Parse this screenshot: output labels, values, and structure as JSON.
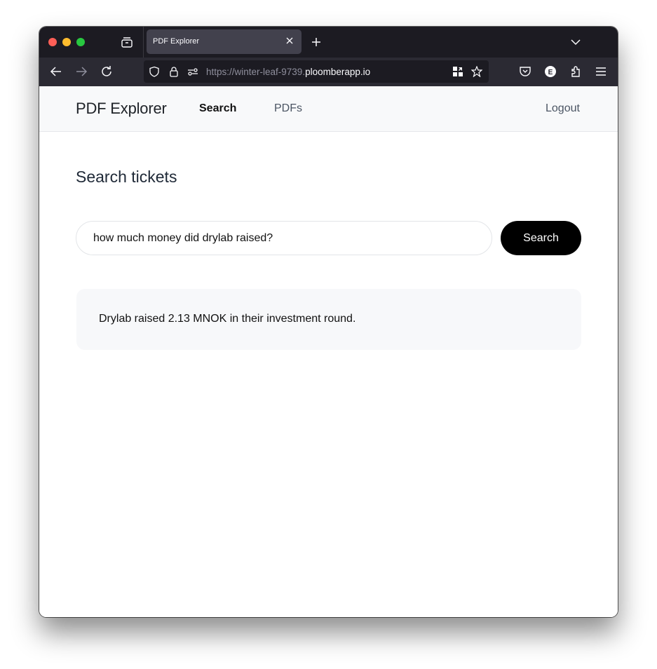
{
  "browser": {
    "tab": {
      "title": "PDF Explorer"
    },
    "url": {
      "scheme_and_subdomain": "https://winter-leaf-9739.",
      "host": "ploomberapp.io"
    },
    "icons": {
      "close_window": "close-window-icon",
      "minimize_window": "minimize-window-icon",
      "maximize_window": "maximize-window-icon",
      "tab_overview": "tab-overview-icon",
      "tab_close": "close-icon",
      "new_tab": "plus-icon",
      "tab_list": "chevron-down-icon",
      "back": "arrow-left-icon",
      "forward": "arrow-right-icon",
      "reload": "reload-icon",
      "tracking_protection": "shield-icon",
      "secure": "lock-icon",
      "permissions": "permissions-icon",
      "qr_code": "qr-code-icon",
      "bookmark": "star-icon",
      "pocket": "pocket-icon",
      "extension_e": "extension-e-icon",
      "extensions": "puzzle-icon",
      "menu": "hamburger-menu-icon"
    }
  },
  "site": {
    "brand": "PDF Explorer",
    "nav": {
      "search": "Search",
      "pdfs": "PDFs",
      "logout": "Logout"
    }
  },
  "main": {
    "title": "Search tickets",
    "search": {
      "value": "how much money did drylab raised?",
      "button_label": "Search"
    },
    "result": {
      "text": "Drylab raised 2.13 MNOK in their investment round."
    }
  }
}
